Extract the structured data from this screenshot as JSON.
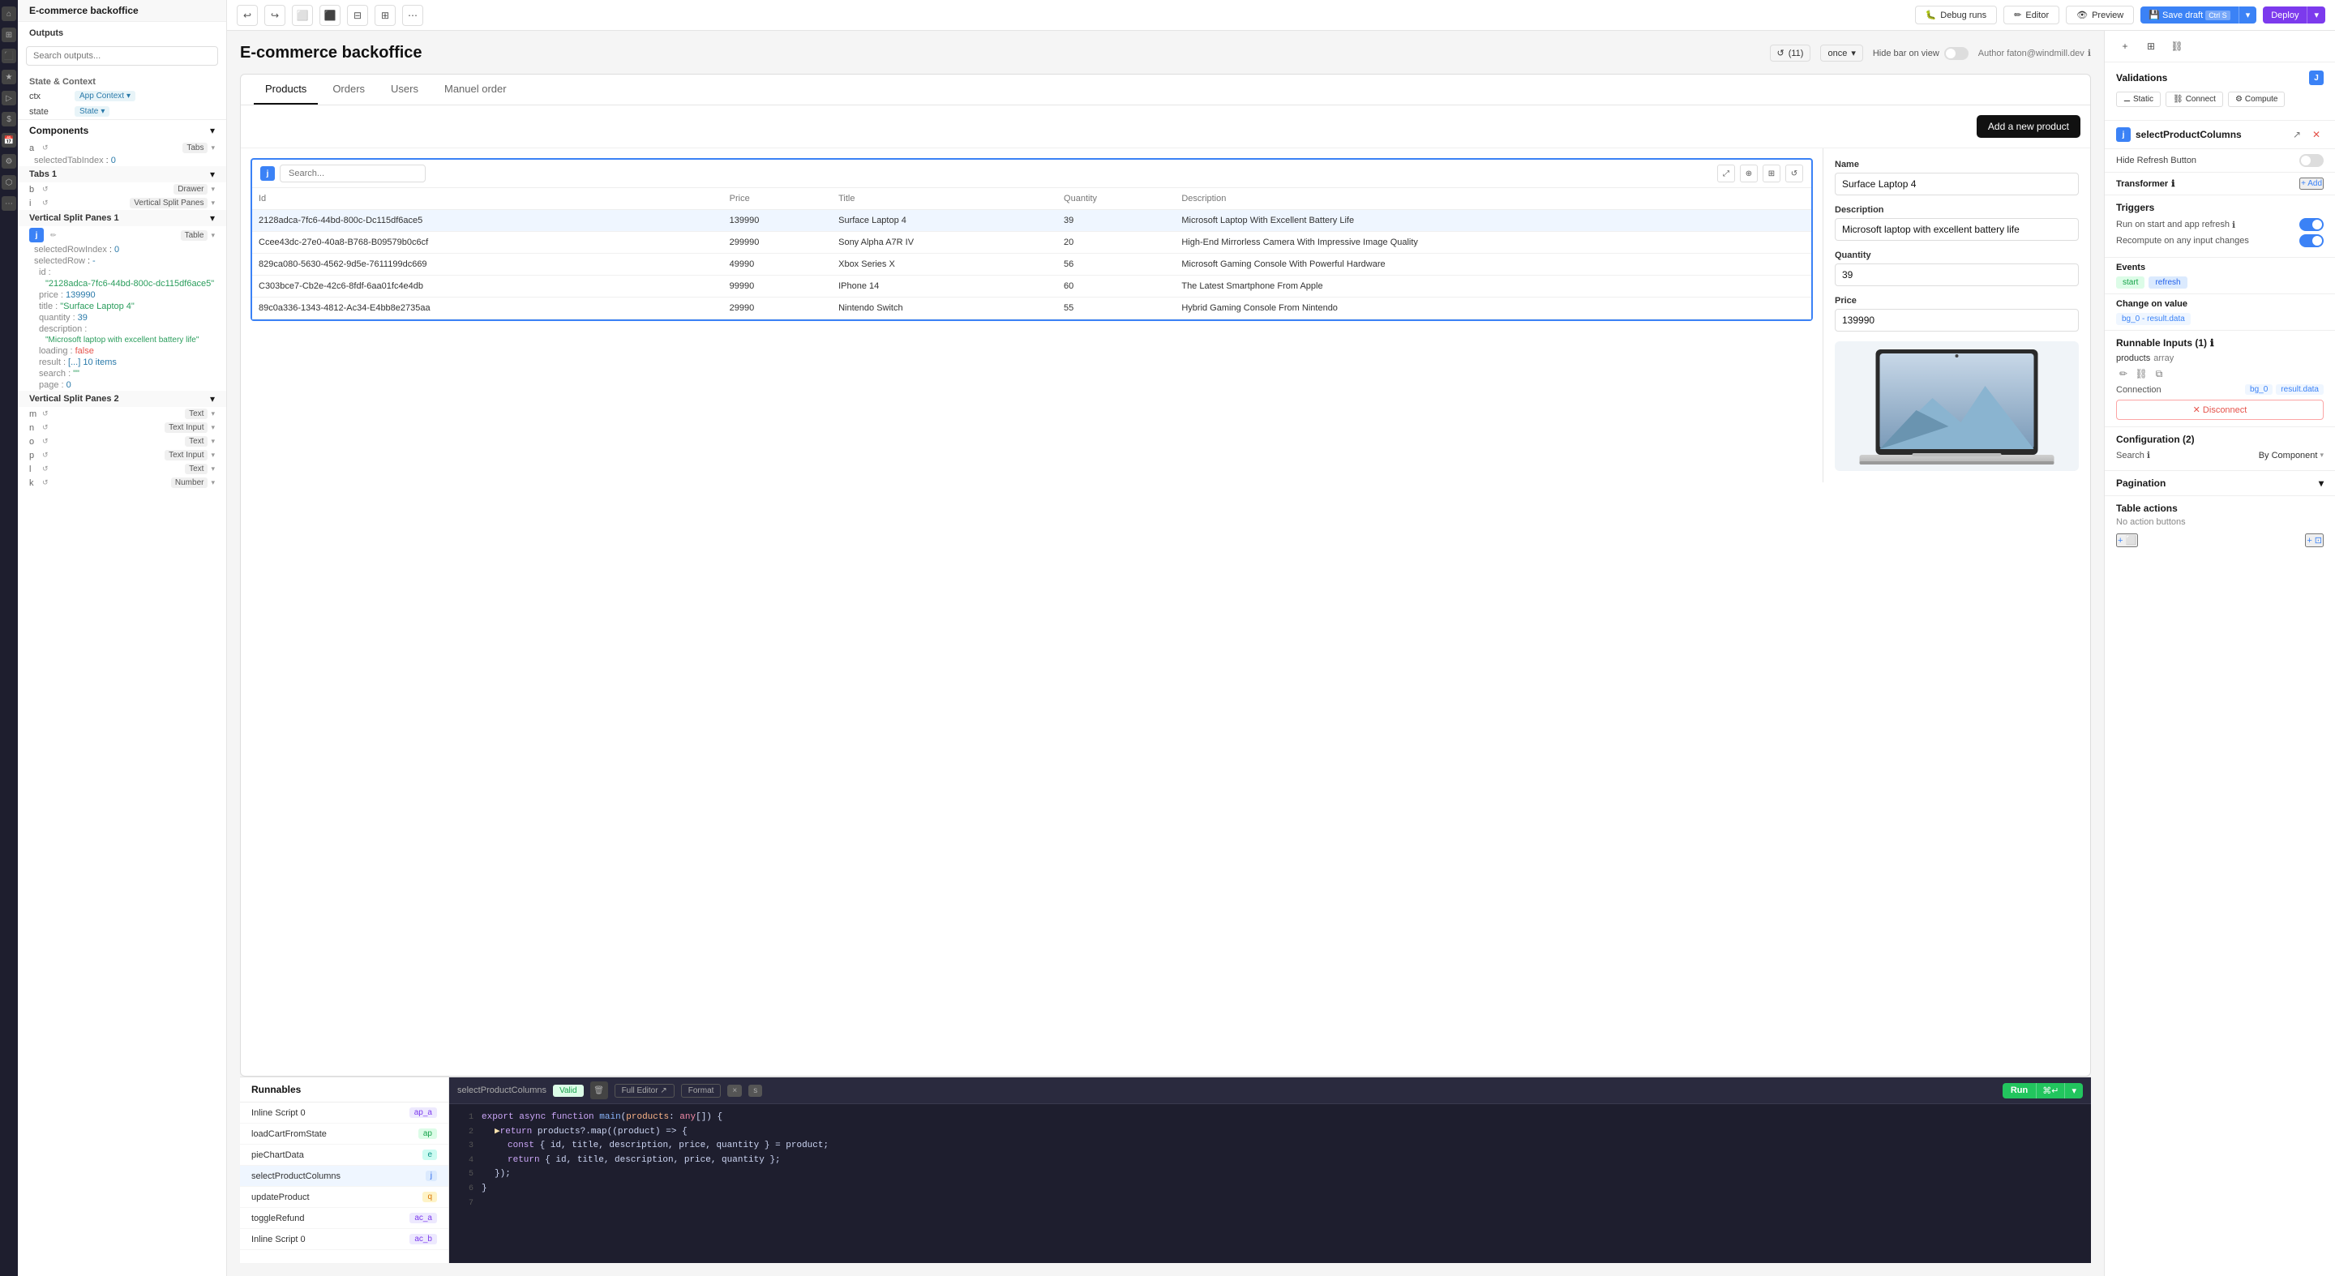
{
  "app": {
    "title": "E-commerce backoffice",
    "topbar": {
      "debug_label": "Debug runs",
      "editor_label": "Editor",
      "preview_label": "Preview",
      "save_label": "Save draft",
      "save_shortcut": "Ctrl S",
      "deploy_label": "Deploy"
    }
  },
  "left_panel": {
    "title": "E-commerce backoffice",
    "outputs_title": "Outputs",
    "search_placeholder": "Search outputs...",
    "state_context_title": "State & Context",
    "ctx_label": "ctx",
    "ctx_type": "App Context",
    "state_label": "state",
    "state_type": "State",
    "components_title": "Components",
    "items": [
      {
        "letter": "a",
        "name": "Tabs",
        "index_label": "selectedTabIndex",
        "index_val": "0"
      },
      {
        "letter": "b",
        "name": "Drawer",
        "type": "Tabs 1"
      },
      {
        "letter": "i",
        "name": "Vertical Split Panes",
        "group": "Vertical Split Panes 1"
      }
    ],
    "vsp1": {
      "name": "Vertical Split Panes 1",
      "letter": "j",
      "type": "Table",
      "selectedRowIndex": "0",
      "selectedRow": "-",
      "id_val": "\"2128adca-7fc6-44bd-800c-dc115df6ace5\"",
      "price_val": "139990",
      "title_val": "\"Surface Laptop 4\"",
      "quantity_val": "39",
      "description_val": "\"Microsoft laptop with excellent battery life\"",
      "loading_val": "false",
      "result_val": "[...] 10 items",
      "search_val": "\"\"",
      "page_val": "0"
    },
    "vsp2": {
      "name": "Vertical Split Panes 2",
      "items": [
        {
          "letter": "m",
          "type": "Text"
        },
        {
          "letter": "n",
          "type": "Text Input"
        },
        {
          "letter": "o",
          "type": "Text"
        },
        {
          "letter": "p",
          "type": "Text Input"
        },
        {
          "letter": "l",
          "type": "Text"
        },
        {
          "letter": "k",
          "type": "Number"
        }
      ]
    }
  },
  "canvas": {
    "app_title": "E-commerce backoffice",
    "refresh_count": "(11)",
    "once_label": "once",
    "hide_bar_label": "Hide bar on view",
    "author_label": "Author faton@windmill.dev",
    "tabs": [
      "Products",
      "Orders",
      "Users",
      "Manuel order"
    ],
    "active_tab": "Products",
    "add_product_btn": "Add a new product",
    "table": {
      "search_placeholder": "Search...",
      "columns": [
        "Id",
        "Price",
        "Title",
        "Quantity",
        "Description"
      ],
      "rows": [
        {
          "id": "2128adca-7fc6-44bd-800c-Dc115df6ace5",
          "price": "139990",
          "title": "Surface Laptop 4",
          "quantity": "39",
          "description": "Microsoft Laptop With Excellent Battery Life",
          "selected": true
        },
        {
          "id": "Ccee43dc-27e0-40a8-B768-B09579b0c6cf",
          "price": "299990",
          "title": "Sony Alpha A7R IV",
          "quantity": "20",
          "description": "High-End Mirrorless Camera With Impressive Image Quality"
        },
        {
          "id": "829ca080-5630-4562-9d5e-7611199dc669",
          "price": "49990",
          "title": "Xbox Series X",
          "quantity": "56",
          "description": "Microsoft Gaming Console With Powerful Hardware"
        },
        {
          "id": "C303bce7-Cb2e-42c6-8fdf-6aa01fc4e4db",
          "price": "99990",
          "title": "IPhone 14",
          "quantity": "60",
          "description": "The Latest Smartphone From Apple"
        },
        {
          "id": "89c0a336-1343-4812-Ac34-E4bb8e2735aa",
          "price": "29990",
          "title": "Nintendo Switch",
          "quantity": "55",
          "description": "Hybrid Gaming Console From Nintendo"
        }
      ]
    },
    "detail": {
      "name_label": "Name",
      "name_val": "Surface Laptop 4",
      "description_label": "Description",
      "description_val": "Microsoft laptop with excellent battery life",
      "quantity_label": "Quantity",
      "quantity_val": "39",
      "price_label": "Price",
      "price_val": "139990"
    }
  },
  "right_panel": {
    "validations_title": "Validations",
    "j_badge": "J",
    "static_btn": "Static",
    "connect_btn": "Connect",
    "compute_btn": "Compute",
    "component_name": "selectProductColumns",
    "hide_refresh_label": "Hide Refresh Button",
    "transformer_label": "Transformer",
    "add_label": "+ Add",
    "triggers_title": "Triggers",
    "run_start_label": "Run on start and app refresh",
    "recompute_label": "Recompute on any input changes",
    "events_title": "Events",
    "event_start": "start",
    "event_refresh": "refresh",
    "cov_title": "Change on value",
    "cov_badge": "bg_0 - result.data",
    "inputs_title": "Runnable Inputs (1)",
    "input_name": "products",
    "input_type": "array",
    "connection_label": "Connection",
    "conn_tag1": "bg_0",
    "conn_tag2": "result.data",
    "disconnect_btn": "✕ Disconnect",
    "config_title": "Configuration (2)",
    "search_label": "Search",
    "search_info": "",
    "search_value": "By Component",
    "pagination_title": "Pagination",
    "table_actions_title": "Table actions",
    "no_action_buttons": "No action buttons"
  },
  "runnables": {
    "title": "Runnables",
    "items": [
      {
        "name": "Inline Script 0",
        "badge": "ap_a",
        "badge_type": "purple"
      },
      {
        "name": "loadCartFromState",
        "badge": "ap",
        "badge_type": "green"
      },
      {
        "name": "pieChartData",
        "badge": "e",
        "badge_type": "teal"
      },
      {
        "name": "selectProductColumns",
        "badge": "j",
        "badge_type": "blue",
        "active": true
      },
      {
        "name": "updateProduct",
        "badge": "q",
        "badge_type": "orange"
      },
      {
        "name": "toggleRefund",
        "badge": "ac_a",
        "badge_type": "purple"
      },
      {
        "name": "Inline Script 0",
        "badge": "ac_b",
        "badge_type": "purple"
      }
    ]
  },
  "code_editor": {
    "filename": "selectProductColumns",
    "valid_label": "Valid",
    "full_editor_label": "Full Editor ↗",
    "format_label": "Format",
    "shortcut_x": "×",
    "shortcut_s": "s",
    "run_label": "Run",
    "run_shortcut": "⌘↵",
    "lines": [
      "export async function main(products: any[]) {",
      "  ▶return products?.map((product) => {",
      "    const { id, title, description, price, quantity } = product;",
      "    return { id, title, description, price, quantity };",
      "  });",
      "}",
      ""
    ]
  }
}
